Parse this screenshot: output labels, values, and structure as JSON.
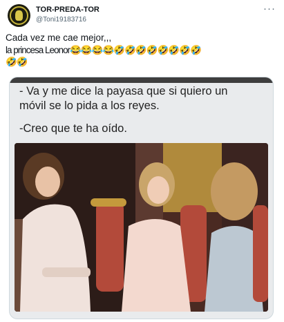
{
  "tweet": {
    "display_name": "TOR-PREDA-TOR",
    "handle": "@Toni19183716",
    "more_icon": "more-dots-icon",
    "text_line1": "Cada vez me cae mejor,,,",
    "text_line2": "la princesa Leonor😂😂😂😂🤣🤣🤣🤣🤣🤣🤣🤣",
    "text_line3": "🤣🤣"
  },
  "media": {
    "caption_line1": "- Va y me dice la payasa que si quiero un",
    "caption_line2": "móvil se lo pida a los reyes.",
    "caption_line3": "-Creo que te ha oído."
  },
  "colors": {
    "text_primary": "#0f1419",
    "text_secondary": "#536471",
    "border": "#cfd9de",
    "meme_background": "#e9ebed"
  }
}
